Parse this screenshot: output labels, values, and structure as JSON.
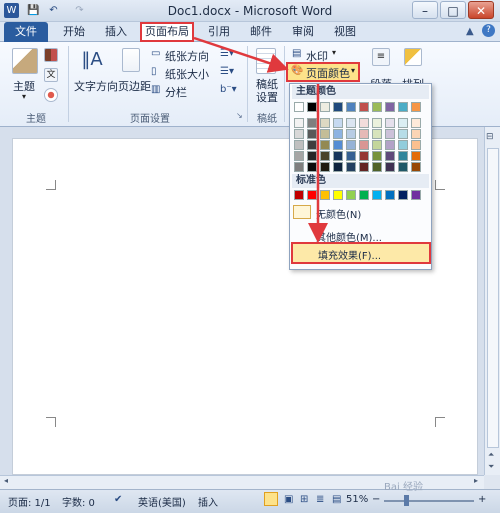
{
  "window": {
    "title": "Doc1.docx - Microsoft Word",
    "minimize": "–",
    "maximize": "□",
    "close": "✕"
  },
  "quick_access": {
    "app_icon": "W",
    "save": "💾",
    "undo": "↶",
    "redo": "↷"
  },
  "tabs": [
    {
      "label": "文件"
    },
    {
      "label": "开始"
    },
    {
      "label": "插入"
    },
    {
      "label": "页面布局"
    },
    {
      "label": "引用"
    },
    {
      "label": "邮件"
    },
    {
      "label": "审阅"
    },
    {
      "label": "视图"
    }
  ],
  "ribbon": {
    "theme_group": {
      "label": "主题",
      "theme_button": "主题"
    },
    "page_setup_group": {
      "label": "页面设置",
      "text_direction": "文字方向",
      "margins": "页边距",
      "orientation": "纸张方向",
      "size": "纸张大小",
      "columns": "分栏"
    },
    "draft_group": {
      "label": "稿纸",
      "draft_button": "稿纸\n设置"
    },
    "page_background": {
      "watermark": "水印",
      "page_color": "页面颜色"
    },
    "paragraph": {
      "label": "段落"
    },
    "arrange": {
      "label": "排列"
    }
  },
  "dropdown": {
    "theme_colors_heading": "主题颜色",
    "standard_colors_heading": "标准色",
    "no_color": "无颜色(N)",
    "more_colors": "其他颜色(M)...",
    "fill_effects": "填充效果(F)...",
    "theme_top_row": [
      "#ffffff",
      "#000000",
      "#eeece1",
      "#1f497d",
      "#4f81bd",
      "#c0504d",
      "#9bbb59",
      "#8064a2",
      "#4bacc6",
      "#f79646"
    ],
    "theme_shades": [
      [
        "#f2f2f2",
        "#7f7f7f",
        "#ddd9c3",
        "#c6d9f0",
        "#dbe5f1",
        "#f2dcdb",
        "#ebf1dd",
        "#e5e0ec",
        "#dbeef3",
        "#fdeada"
      ],
      [
        "#d8d8d8",
        "#595959",
        "#c4bd97",
        "#8db3e2",
        "#b8cce4",
        "#e5b9b7",
        "#d7e3bc",
        "#ccc1d9",
        "#b7dde8",
        "#fbd5b5"
      ],
      [
        "#bfbfbf",
        "#3f3f3f",
        "#938953",
        "#548dd4",
        "#95b3d7",
        "#d99694",
        "#c3d69b",
        "#b2a2c7",
        "#92cddc",
        "#fac08f"
      ],
      [
        "#a5a5a5",
        "#262626",
        "#494429",
        "#17365d",
        "#366092",
        "#953734",
        "#76923c",
        "#5f497a",
        "#31859b",
        "#e36c09"
      ],
      [
        "#7f7f7f",
        "#0c0c0c",
        "#1d1b10",
        "#0f243e",
        "#244061",
        "#632423",
        "#4f6128",
        "#3f3151",
        "#205867",
        "#974806"
      ]
    ],
    "standard_colors": [
      "#c00000",
      "#ff0000",
      "#ffc000",
      "#ffff00",
      "#92d050",
      "#00b050",
      "#00b0f0",
      "#0070c0",
      "#002060",
      "#7030a0"
    ]
  },
  "status": {
    "page": "页面: 1/1",
    "words": "字数: 0",
    "language": "英语(美国)",
    "mode": "插入",
    "zoom": "51%",
    "zoom_out": "−",
    "zoom_in": "+"
  }
}
